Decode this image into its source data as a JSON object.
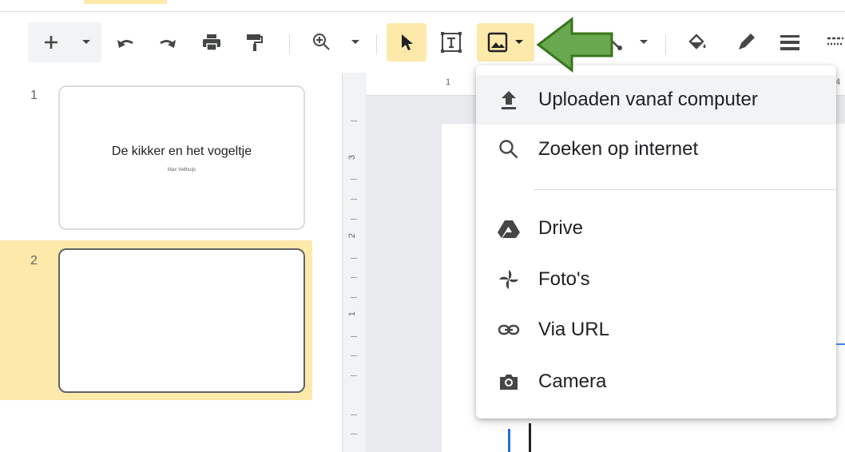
{
  "filmstrip": {
    "slides": [
      {
        "number": "1",
        "title": "De kikker en het vogeltje",
        "subtitle": "Max Velthuijs"
      },
      {
        "number": "2",
        "title": "",
        "subtitle": ""
      }
    ]
  },
  "ruler": {
    "horizontal": [
      "1",
      "4"
    ],
    "vertical": [
      "3",
      "2",
      "1"
    ]
  },
  "insert_image_menu": {
    "items": [
      {
        "label": "Uploaden vanaf computer",
        "icon": "upload-icon"
      },
      {
        "label": "Zoeken op internet",
        "icon": "search-icon"
      },
      {
        "label": "Drive",
        "icon": "google-drive-icon"
      },
      {
        "label": "Foto's",
        "icon": "google-photos-icon"
      },
      {
        "label": "Via URL",
        "icon": "link-icon"
      },
      {
        "label": "Camera",
        "icon": "camera-icon"
      }
    ]
  },
  "colors": {
    "selection": "#fde9a9",
    "arrow_fill": "#6aa84f",
    "arrow_stroke": "#38761d",
    "icon": "#444746"
  }
}
